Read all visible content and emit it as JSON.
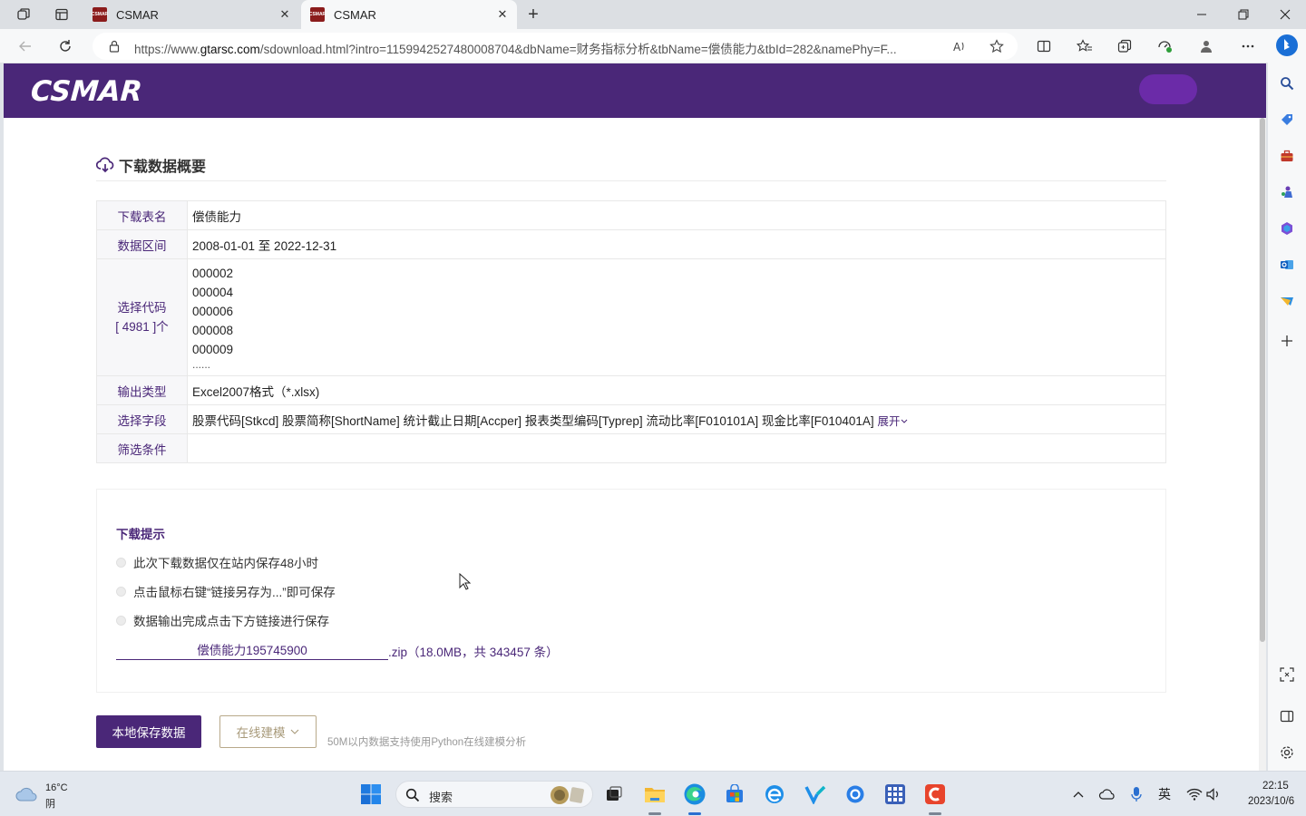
{
  "browser": {
    "tabs": [
      {
        "title": "CSMAR",
        "favicon": "CSMAR"
      },
      {
        "title": "CSMAR",
        "favicon": "CSMAR"
      }
    ],
    "url": {
      "prefix": "https://www.",
      "host": "gtarsc.com",
      "path": "/sdownload.html?intro=1159942527480008704&dbName=财务指标分析&tbName=偿债能力&tbId=282&namePhy=F..."
    }
  },
  "site": {
    "logo": "CSMAR",
    "brand_color": "#4a2778"
  },
  "summary": {
    "title": "下载数据概要",
    "rows": {
      "table_name": {
        "label": "下载表名",
        "value": "偿债能力"
      },
      "date_range": {
        "label": "数据区间",
        "value": "2008-01-01 至 2022-12-31"
      },
      "codes": {
        "label": "选择代码",
        "count_label": "[ 4981 ]个",
        "items": [
          "000002",
          "000004",
          "000006",
          "000008",
          "000009"
        ],
        "ellipsis": "......"
      },
      "output_type": {
        "label": "输出类型",
        "value": "Excel2007格式（*.xlsx)"
      },
      "fields": {
        "label": "选择字段",
        "value": "股票代码[Stkcd] 股票简称[ShortName] 统计截止日期[Accper] 报表类型编码[Typrep] 流动比率[F010101A] 现金比率[F010401A]",
        "expand": "展开"
      },
      "filter": {
        "label": "筛选条件",
        "value": ""
      }
    }
  },
  "tips": {
    "title": "下载提示",
    "items": [
      "此次下载数据仅在站内保存48小时",
      "点击鼠标右键“链接另存为...”即可保存",
      "数据输出完成点击下方链接进行保存"
    ],
    "download": {
      "filename": "偿债能力195745900",
      "info": ".zip（18.0MB，共 343457 条）"
    }
  },
  "actions": {
    "save_local": "本地保存数据",
    "online_model": "在线建模",
    "note": "50M以内数据支持使用Python在线建模分析"
  },
  "taskbar": {
    "weather_temp": "16°C",
    "weather_desc": "阴",
    "search_placeholder": "搜索",
    "ime": "英",
    "time": "22:15",
    "date": "2023/10/6"
  }
}
